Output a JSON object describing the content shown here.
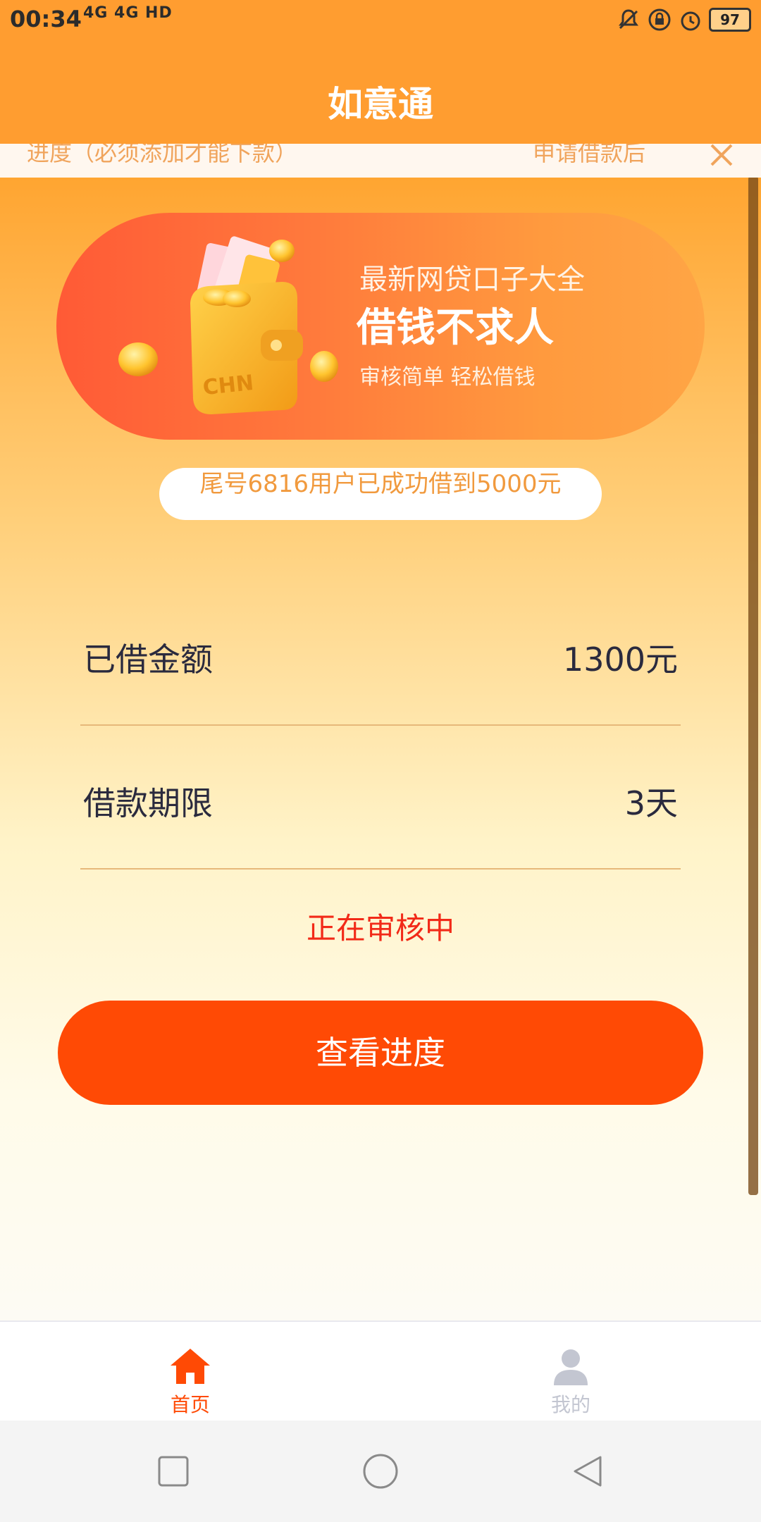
{
  "status_bar": {
    "time": "00:34",
    "network": "4G 4G HD",
    "battery": "97"
  },
  "header": {
    "title": "如意通"
  },
  "notice": {
    "text1": "进度（必须添加才能下款）",
    "text2": "申请借款后"
  },
  "banner": {
    "line1": "最新网贷口子大全",
    "line2": "借钱不求人",
    "line3": "审核简单  轻松借钱",
    "wallet_text": "CHN"
  },
  "marquee": "尾号6816用户已成功借到5000元",
  "loan": {
    "amount_label": "已借金额",
    "amount_value": "1300元",
    "term_label": "借款期限",
    "term_value": "3天"
  },
  "review_status": "正在审核中",
  "cta_label": "查看进度",
  "bottom_nav": {
    "home_label": "首页",
    "home_color": "#ff4a05",
    "mine_label": "我的",
    "mine_color": "#c3c6d1"
  },
  "colors": {
    "accent": "#ff9d30",
    "cta": "#ff4a05",
    "status_red": "#f22a18"
  },
  "icons": [
    "home-icon",
    "user-icon",
    "close-icon",
    "square-icon",
    "circle-icon",
    "back-triangle-icon"
  ]
}
